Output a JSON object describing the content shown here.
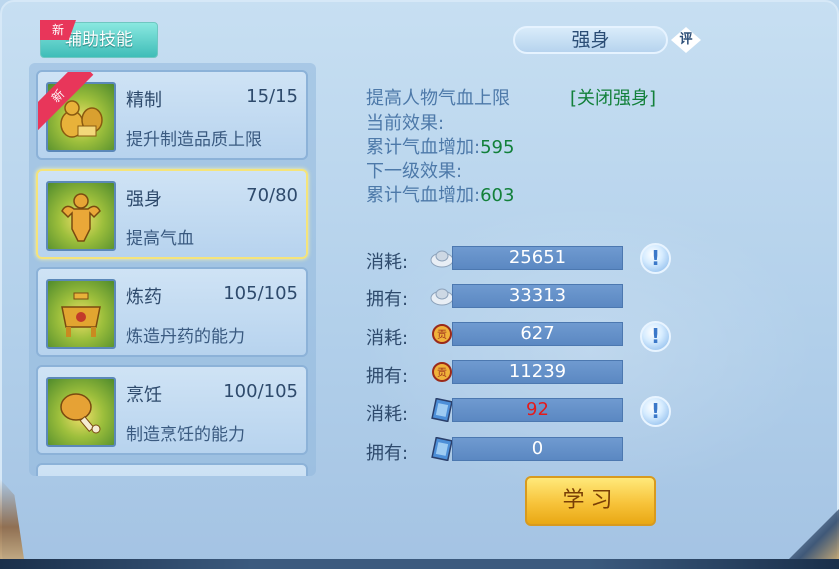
{
  "tab": {
    "label": "辅助技能",
    "new_badge": "新"
  },
  "skills": [
    {
      "name": "精制",
      "level": "15/15",
      "desc": "提升制造品质上限",
      "new_badge": "新",
      "icon": "gourd-tools-icon"
    },
    {
      "name": "强身",
      "level": "70/80",
      "desc": "提高气血",
      "icon": "muscle-man-icon"
    },
    {
      "name": "炼药",
      "level": "105/105",
      "desc": "炼造丹药的能力",
      "icon": "cauldron-icon"
    },
    {
      "name": "烹饪",
      "level": "100/105",
      "desc": "制造烹饪的能力",
      "icon": "drumstick-icon"
    }
  ],
  "detail": {
    "title": "强身",
    "rate_label": "评",
    "line1": "提高人物气血上限",
    "close_link": "[关闭强身]",
    "current_label": "当前效果:",
    "current_effect_label": "累计气血增加:",
    "current_effect_value": "595",
    "next_label": "下一级效果:",
    "next_effect_label": "累计气血增加:",
    "next_effect_value": "603"
  },
  "costs": [
    {
      "label": "消耗:",
      "icon": "silver-ingot-icon",
      "value": "25651",
      "info": "!"
    },
    {
      "label": "拥有:",
      "icon": "silver-ingot-icon",
      "value": "33313"
    },
    {
      "label": "消耗:",
      "icon": "contribution-medal-icon",
      "value": "627",
      "info": "!"
    },
    {
      "label": "拥有:",
      "icon": "contribution-medal-icon",
      "value": "11239"
    },
    {
      "label": "消耗:",
      "icon": "skill-book-icon",
      "value": "92",
      "info": "!"
    },
    {
      "label": "拥有:",
      "icon": "skill-book-icon",
      "value": "0"
    }
  ],
  "learn_button": "学习",
  "colors": {
    "accent_green": "#12803a",
    "insufficient_red": "#e41b1b",
    "tab_teal": "#3fbdb8",
    "button_gold": "#f7c33a"
  }
}
